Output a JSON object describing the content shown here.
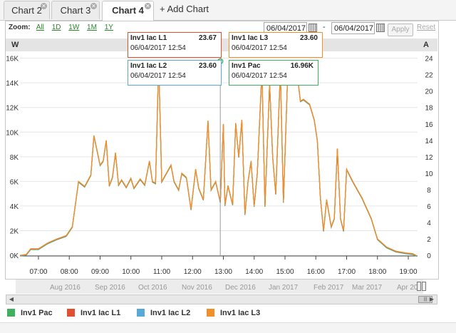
{
  "tabs": [
    {
      "label": "Chart 2",
      "active": false
    },
    {
      "label": "Chart 3",
      "active": false
    },
    {
      "label": "Chart 4",
      "active": true
    }
  ],
  "add_chart_label": "+ Add Chart",
  "toolbar": {
    "zoom_label": "Zoom:",
    "zoom_levels": [
      "All",
      "1D",
      "1W",
      "1M",
      "1Y"
    ],
    "date_from": "06/04/2017",
    "date_sep": "-",
    "date_to": "06/04/2017",
    "apply_label": "Apply",
    "reset_label": "Reset"
  },
  "tooltips": [
    {
      "name": "Inv1 Iac L1",
      "value": "23.67",
      "time": "06/04/2017  12:54",
      "color": "#e05030"
    },
    {
      "name": "Inv1 Iac L3",
      "value": "23.60",
      "time": "06/04/2017  12:54",
      "color": "#f0902a"
    },
    {
      "name": "Inv1 Iac L2",
      "value": "23.60",
      "time": "06/04/2017  12:54",
      "color": "#58a8d8"
    },
    {
      "name": "Inv1 Pac",
      "value": "16.96K",
      "time": "06/04/2017  12:54",
      "color": "#40b060"
    }
  ],
  "navigator_labels": [
    "Aug 2016",
    "Sep 2016",
    "Oct 2016",
    "Nov 2016",
    "Dec 2016",
    "Jan 2017",
    "Feb 2017",
    "Mar 2017",
    "Apr 20"
  ],
  "legend": [
    {
      "name": "Inv1 Pac",
      "color": "#40b060"
    },
    {
      "name": "Inv1 Iac L1",
      "color": "#e05030"
    },
    {
      "name": "Inv1 Iac L2",
      "color": "#58a8d8"
    },
    {
      "name": "Inv1 Iac L3",
      "color": "#f0902a"
    }
  ],
  "chart_data": {
    "type": "line",
    "y_left_unit": "W",
    "y_right_unit": "A",
    "y_left_ticks": [
      "0K",
      "2K",
      "4K",
      "6K",
      "8K",
      "10K",
      "12K",
      "14K",
      "16K"
    ],
    "y_right_ticks": [
      "0",
      "2",
      "4",
      "6",
      "8",
      "10",
      "12",
      "14",
      "16",
      "18",
      "20",
      "22",
      "24"
    ],
    "ylim_left": [
      0,
      16500
    ],
    "ylim_right": [
      0,
      24.75
    ],
    "x_ticks": [
      "07:00",
      "08:00",
      "09:00",
      "10:00",
      "11:00",
      "12:00",
      "13:00",
      "14:00",
      "15:00",
      "16:00",
      "17:00",
      "18:00",
      "19:00"
    ],
    "x_range_hours": [
      6.4,
      19.3
    ],
    "series": [
      {
        "name": "Inv1 Iac L3",
        "axis": "right",
        "color": "#f0902a",
        "points": [
          [
            6.4,
            0
          ],
          [
            6.6,
            0.1
          ],
          [
            6.75,
            0.8
          ],
          [
            7.0,
            0.8
          ],
          [
            7.3,
            1.5
          ],
          [
            7.6,
            2
          ],
          [
            7.9,
            2.4
          ],
          [
            8.1,
            3.5
          ],
          [
            8.3,
            9
          ],
          [
            8.5,
            8.4
          ],
          [
            8.7,
            9.8
          ],
          [
            8.8,
            14.6
          ],
          [
            9.0,
            11
          ],
          [
            9.1,
            11.5
          ],
          [
            9.2,
            14
          ],
          [
            9.3,
            8.5
          ],
          [
            9.4,
            9.5
          ],
          [
            9.5,
            12.5
          ],
          [
            9.6,
            8.6
          ],
          [
            9.7,
            9.2
          ],
          [
            9.85,
            8.3
          ],
          [
            10.0,
            9.4
          ],
          [
            10.1,
            8.2
          ],
          [
            10.3,
            9.3
          ],
          [
            10.45,
            8.6
          ],
          [
            10.6,
            11.5
          ],
          [
            10.7,
            9
          ],
          [
            10.8,
            8.8
          ],
          [
            10.9,
            23.6
          ],
          [
            11.0,
            9
          ],
          [
            11.15,
            10
          ],
          [
            11.3,
            11
          ],
          [
            11.4,
            9
          ],
          [
            11.55,
            8
          ],
          [
            11.65,
            10
          ],
          [
            11.8,
            9.5
          ],
          [
            11.95,
            5.6
          ],
          [
            12.1,
            10.5
          ],
          [
            12.2,
            8.2
          ],
          [
            12.35,
            6.8
          ],
          [
            12.5,
            16.4
          ],
          [
            12.6,
            8
          ],
          [
            12.75,
            9
          ],
          [
            12.9,
            6.5
          ],
          [
            13.0,
            16
          ],
          [
            13.05,
            6.1
          ],
          [
            13.15,
            8.5
          ],
          [
            13.3,
            6.2
          ],
          [
            13.4,
            16.1
          ],
          [
            13.5,
            12
          ],
          [
            13.6,
            16.5
          ],
          [
            13.7,
            5
          ],
          [
            13.8,
            9
          ],
          [
            13.9,
            11.5
          ],
          [
            14.0,
            6
          ],
          [
            14.1,
            10
          ],
          [
            14.25,
            22.5
          ],
          [
            14.35,
            6
          ],
          [
            14.5,
            21
          ],
          [
            14.6,
            12
          ],
          [
            14.7,
            7.5
          ],
          [
            14.85,
            22.5
          ],
          [
            14.95,
            6.5
          ],
          [
            15.1,
            23.5
          ],
          [
            15.2,
            21
          ],
          [
            15.3,
            23.5
          ],
          [
            15.4,
            22
          ],
          [
            15.5,
            18.8
          ],
          [
            15.6,
            19
          ],
          [
            15.8,
            18.4
          ],
          [
            15.95,
            16.5
          ],
          [
            16.05,
            14
          ],
          [
            16.15,
            7
          ],
          [
            16.25,
            3
          ],
          [
            16.35,
            6.8
          ],
          [
            16.5,
            3.5
          ],
          [
            16.6,
            4.5
          ],
          [
            16.7,
            13
          ],
          [
            16.8,
            4.5
          ],
          [
            16.9,
            3
          ],
          [
            17.0,
            10.5
          ],
          [
            17.2,
            9
          ],
          [
            17.5,
            7
          ],
          [
            17.8,
            4.5
          ],
          [
            18.0,
            2
          ],
          [
            18.3,
            1
          ],
          [
            18.6,
            0.5
          ],
          [
            18.9,
            0.3
          ],
          [
            19.15,
            0.2
          ],
          [
            19.25,
            0
          ]
        ]
      }
    ]
  }
}
